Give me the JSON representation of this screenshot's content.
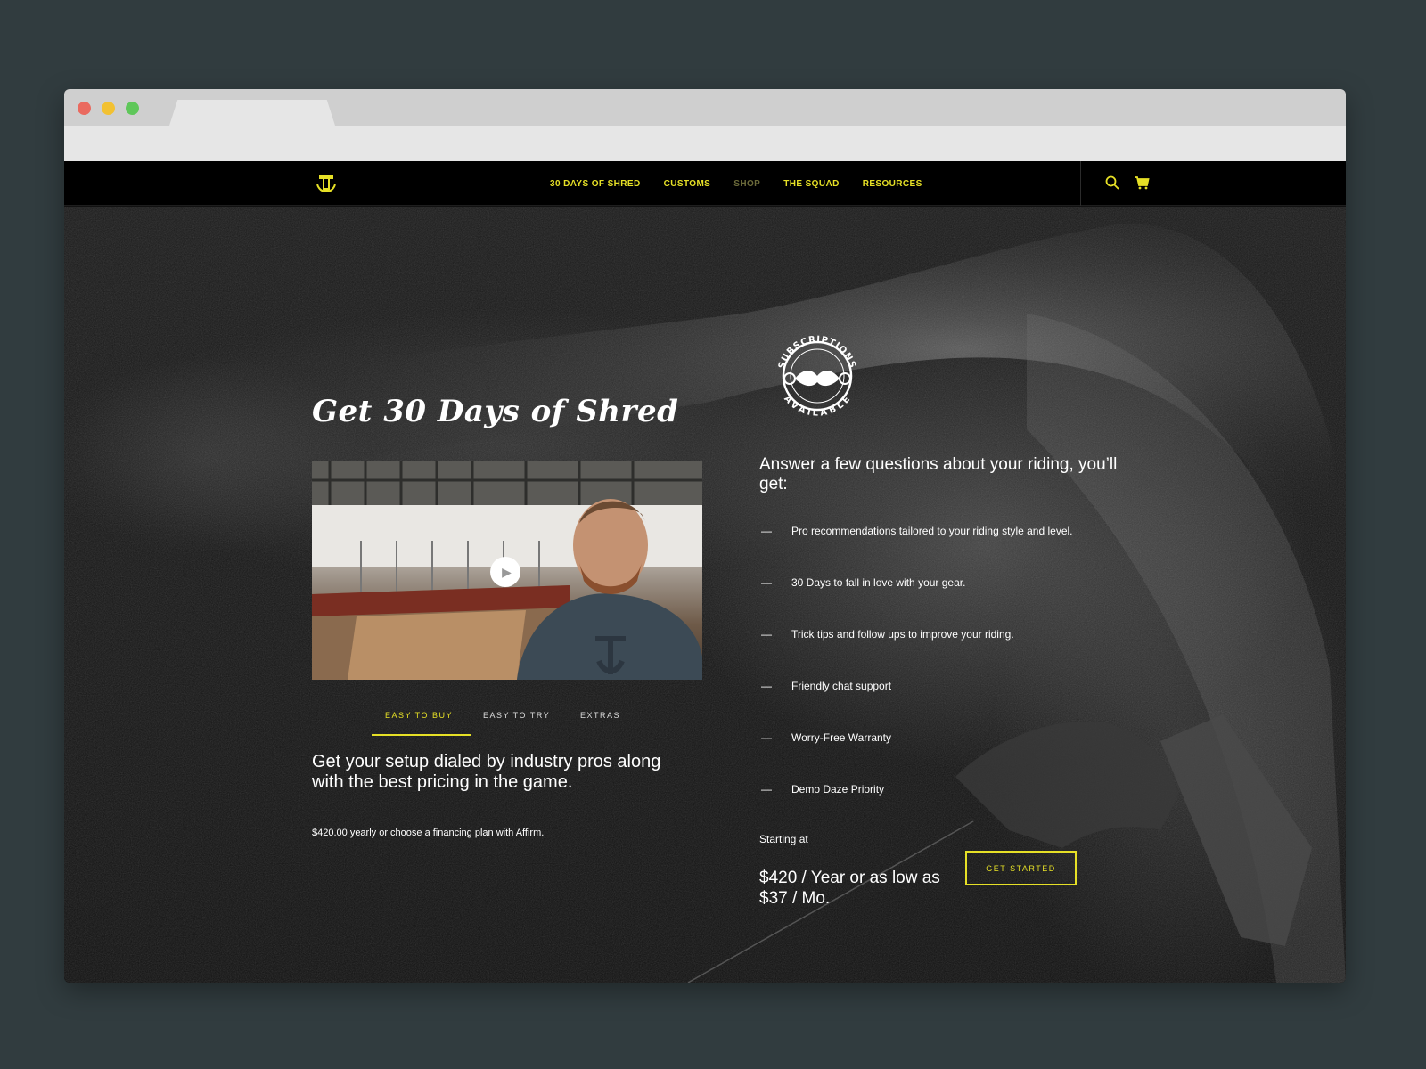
{
  "nav": {
    "links": [
      "30 DAYS OF SHRED",
      "CUSTOMS",
      "SHOP",
      "THE SQUAD",
      "RESOURCES"
    ]
  },
  "hero": {
    "title": "Get 30 Days of Shred"
  },
  "badge": {
    "top_text": "SUBSCRIPTIONS",
    "bottom_text": "AVAILABLE"
  },
  "tabs": [
    "EASY TO BUY",
    "EASY TO TRY",
    "EXTRAS"
  ],
  "pitch": "Get your setup dialed by industry pros along with the best pricing in the game.",
  "price_note": "$420.00 yearly or choose a financing plan with Affirm.",
  "questions_title": "Answer a few questions about your riding, you’ll get:",
  "benefits": [
    "Pro recommendations tailored to your riding style and level.",
    "30 Days to fall in love with your gear.",
    "Trick tips and follow ups to improve your riding.",
    "Friendly chat support",
    "Worry-Free Warranty",
    "Demo Daze Priority"
  ],
  "starting_label": "Starting at",
  "big_price": "$420 / Year or as low as $37 / Mo.",
  "cta": "GET STARTED",
  "colors": {
    "accent": "#e6e026",
    "background": "#313c3f",
    "site_bg": "#111111"
  },
  "icons": {
    "logo": "hyperlite-logo-icon",
    "search": "search-icon",
    "cart": "cart-icon",
    "play": "play-icon"
  }
}
